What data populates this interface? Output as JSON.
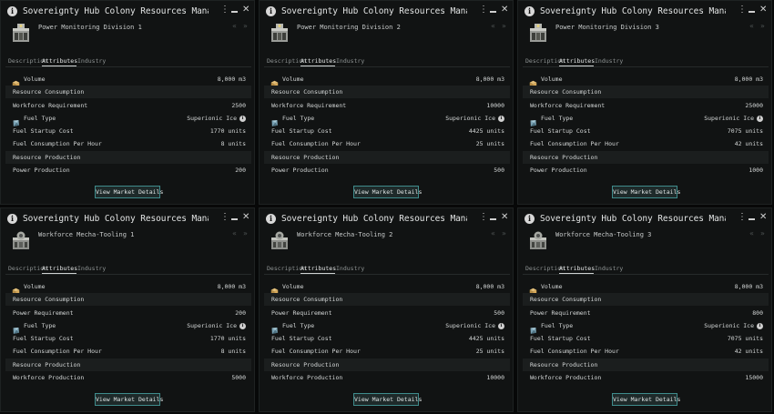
{
  "windows": [
    {
      "title": "Sovereignty Hub Colony Resources Management Upgrades",
      "subtitle": "Power Monitoring Division 1",
      "icon": "power-monitoring-icon",
      "tabs": [
        "Description",
        "Attributes",
        "Industry"
      ],
      "active_tab": "Attributes",
      "rows": [
        {
          "label": "Volume",
          "value": "8,000 m3",
          "type": "icon",
          "icon": "volume-cube-icon"
        },
        {
          "label": "Resource Consumption",
          "value": "",
          "type": "header"
        },
        {
          "label": "Workforce Requirement",
          "value": "2500",
          "type": "plain"
        },
        {
          "label": "Fuel Type",
          "value": "Superionic Ice",
          "type": "icon",
          "icon": "superionic-ice-icon",
          "info": true
        },
        {
          "label": "Fuel Startup Cost",
          "value": "1770 units",
          "type": "plain"
        },
        {
          "label": "Fuel Consumption Per Hour",
          "value": "8 units",
          "type": "plain"
        },
        {
          "label": "Resource Production",
          "value": "",
          "type": "header"
        },
        {
          "label": "Power Production",
          "value": "200",
          "type": "plain"
        }
      ],
      "button": "View Market Details"
    },
    {
      "title": "Sovereignty Hub Colony Resources Management Upgrades",
      "subtitle": "Power Monitoring Division 2",
      "icon": "power-monitoring-icon",
      "tabs": [
        "Description",
        "Attributes",
        "Industry"
      ],
      "active_tab": "Attributes",
      "rows": [
        {
          "label": "Volume",
          "value": "8,000 m3",
          "type": "icon",
          "icon": "volume-cube-icon"
        },
        {
          "label": "Resource Consumption",
          "value": "",
          "type": "header"
        },
        {
          "label": "Workforce Requirement",
          "value": "10000",
          "type": "plain"
        },
        {
          "label": "Fuel Type",
          "value": "Superionic Ice",
          "type": "icon",
          "icon": "superionic-ice-icon",
          "info": true
        },
        {
          "label": "Fuel Startup Cost",
          "value": "4425 units",
          "type": "plain"
        },
        {
          "label": "Fuel Consumption Per Hour",
          "value": "25 units",
          "type": "plain"
        },
        {
          "label": "Resource Production",
          "value": "",
          "type": "header"
        },
        {
          "label": "Power Production",
          "value": "500",
          "type": "plain"
        }
      ],
      "button": "View Market Details"
    },
    {
      "title": "Sovereignty Hub Colony Resources Management Upgrades",
      "subtitle": "Power Monitoring Division 3",
      "icon": "power-monitoring-icon",
      "tabs": [
        "Description",
        "Attributes",
        "Industry"
      ],
      "active_tab": "Attributes",
      "rows": [
        {
          "label": "Volume",
          "value": "8,000 m3",
          "type": "icon",
          "icon": "volume-cube-icon"
        },
        {
          "label": "Resource Consumption",
          "value": "",
          "type": "header"
        },
        {
          "label": "Workforce Requirement",
          "value": "25000",
          "type": "plain"
        },
        {
          "label": "Fuel Type",
          "value": "Superionic Ice",
          "type": "icon",
          "icon": "superionic-ice-icon",
          "info": true
        },
        {
          "label": "Fuel Startup Cost",
          "value": "7075 units",
          "type": "plain"
        },
        {
          "label": "Fuel Consumption Per Hour",
          "value": "42 units",
          "type": "plain"
        },
        {
          "label": "Resource Production",
          "value": "",
          "type": "header"
        },
        {
          "label": "Power Production",
          "value": "1000",
          "type": "plain"
        }
      ],
      "button": "View Market Details"
    },
    {
      "title": "Sovereignty Hub Colony Resources Management Upgrades",
      "subtitle": "Workforce Mecha-Tooling 1",
      "icon": "workforce-tooling-icon",
      "tabs": [
        "Description",
        "Attributes",
        "Industry"
      ],
      "active_tab": "Attributes",
      "rows": [
        {
          "label": "Volume",
          "value": "8,000 m3",
          "type": "icon",
          "icon": "volume-cube-icon"
        },
        {
          "label": "Resource Consumption",
          "value": "",
          "type": "header"
        },
        {
          "label": "Power Requirement",
          "value": "200",
          "type": "plain"
        },
        {
          "label": "Fuel Type",
          "value": "Superionic Ice",
          "type": "icon",
          "icon": "superionic-ice-icon",
          "info": true
        },
        {
          "label": "Fuel Startup Cost",
          "value": "1770 units",
          "type": "plain"
        },
        {
          "label": "Fuel Consumption Per Hour",
          "value": "8 units",
          "type": "plain"
        },
        {
          "label": "Resource Production",
          "value": "",
          "type": "header"
        },
        {
          "label": "Workforce Production",
          "value": "5000",
          "type": "plain"
        }
      ],
      "button": "View Market Details"
    },
    {
      "title": "Sovereignty Hub Colony Resources Management Upgrades",
      "subtitle": "Workforce Mecha-Tooling 2",
      "icon": "workforce-tooling-icon",
      "tabs": [
        "Description",
        "Attributes",
        "Industry"
      ],
      "active_tab": "Attributes",
      "rows": [
        {
          "label": "Volume",
          "value": "8,000 m3",
          "type": "icon",
          "icon": "volume-cube-icon"
        },
        {
          "label": "Resource Consumption",
          "value": "",
          "type": "header"
        },
        {
          "label": "Power Requirement",
          "value": "500",
          "type": "plain"
        },
        {
          "label": "Fuel Type",
          "value": "Superionic Ice",
          "type": "icon",
          "icon": "superionic-ice-icon",
          "info": true
        },
        {
          "label": "Fuel Startup Cost",
          "value": "4425 units",
          "type": "plain"
        },
        {
          "label": "Fuel Consumption Per Hour",
          "value": "25 units",
          "type": "plain"
        },
        {
          "label": "Resource Production",
          "value": "",
          "type": "header"
        },
        {
          "label": "Workforce Production",
          "value": "10000",
          "type": "plain"
        }
      ],
      "button": "View Market Details"
    },
    {
      "title": "Sovereignty Hub Colony Resources Management Upgrades",
      "subtitle": "Workforce Mecha-Tooling 3",
      "icon": "workforce-tooling-icon",
      "tabs": [
        "Description",
        "Attributes",
        "Industry"
      ],
      "active_tab": "Attributes",
      "rows": [
        {
          "label": "Volume",
          "value": "8,000 m3",
          "type": "icon",
          "icon": "volume-cube-icon"
        },
        {
          "label": "Resource Consumption",
          "value": "",
          "type": "header"
        },
        {
          "label": "Power Requirement",
          "value": "800",
          "type": "plain"
        },
        {
          "label": "Fuel Type",
          "value": "Superionic Ice",
          "type": "icon",
          "icon": "superionic-ice-icon",
          "info": true
        },
        {
          "label": "Fuel Startup Cost",
          "value": "7075 units",
          "type": "plain"
        },
        {
          "label": "Fuel Consumption Per Hour",
          "value": "42 units",
          "type": "plain"
        },
        {
          "label": "Resource Production",
          "value": "",
          "type": "header"
        },
        {
          "label": "Workforce Production",
          "value": "15000",
          "type": "plain"
        }
      ],
      "button": "View Market Details"
    }
  ],
  "glyphs": {
    "info": "i",
    "menu": "⋮",
    "close": "✕",
    "back": "«",
    "forward": "»"
  }
}
